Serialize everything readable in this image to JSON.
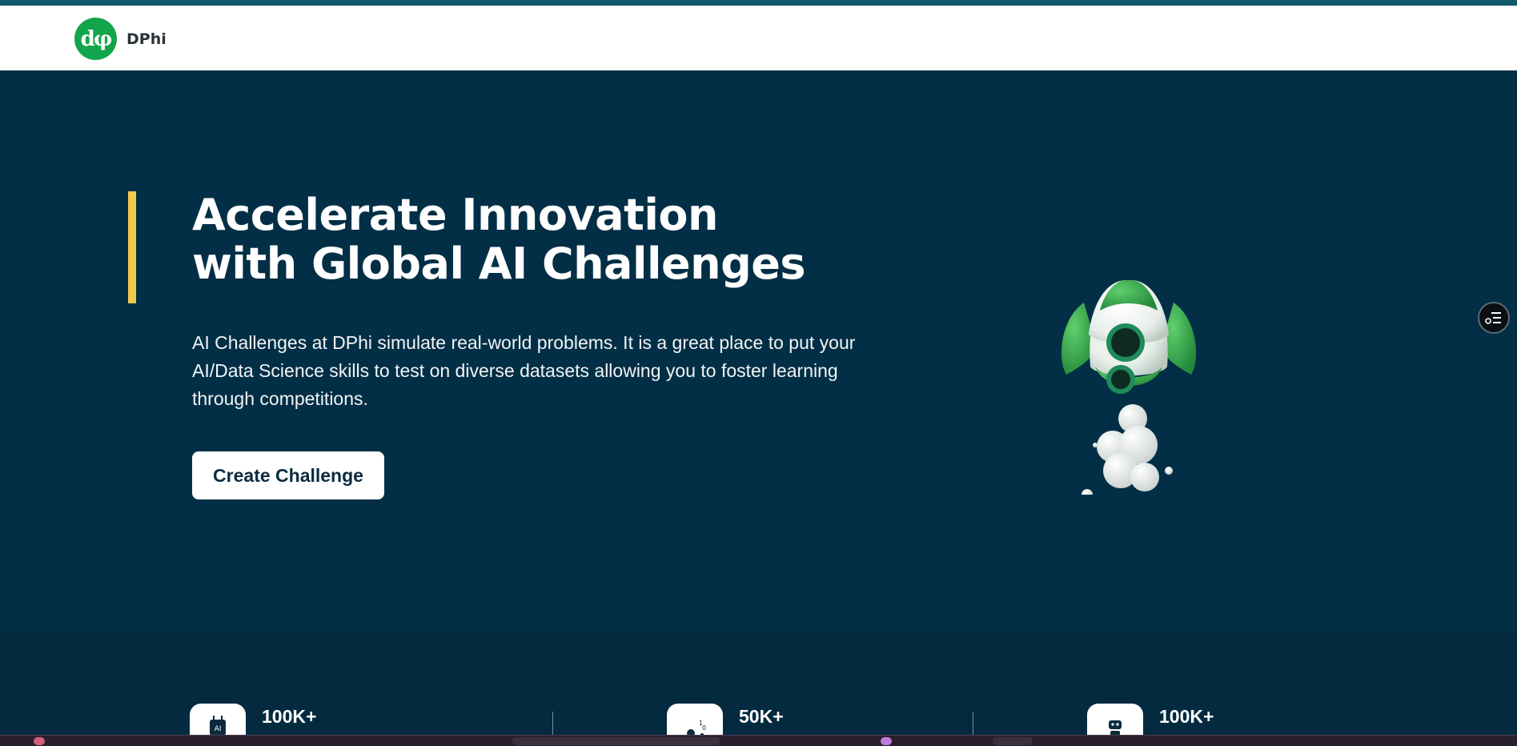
{
  "brand": {
    "name": "DPhi",
    "logo_glyph": "dφ",
    "color": "#12a54b"
  },
  "hero": {
    "title_line1": "Accelerate Innovation",
    "title_line2": "with Global AI Challenges",
    "description": "AI Challenges at DPhi simulate real-world problems. It is a great place to put your AI/Data Science skills to test on diverse datasets allowing you to foster learning through competitions.",
    "cta_label": "Create Challenge",
    "accent_color": "#f2c94c",
    "background_color": "#022f45",
    "illustration": "rocket-illustration"
  },
  "floating_button": {
    "icon": "settings-list-icon"
  },
  "stats": [
    {
      "value": "100K+",
      "icon": "ai-chip-icon"
    },
    {
      "value": "50K+",
      "icon": "data-science-icon"
    },
    {
      "value": "100K+",
      "icon": "robot-icon"
    }
  ]
}
